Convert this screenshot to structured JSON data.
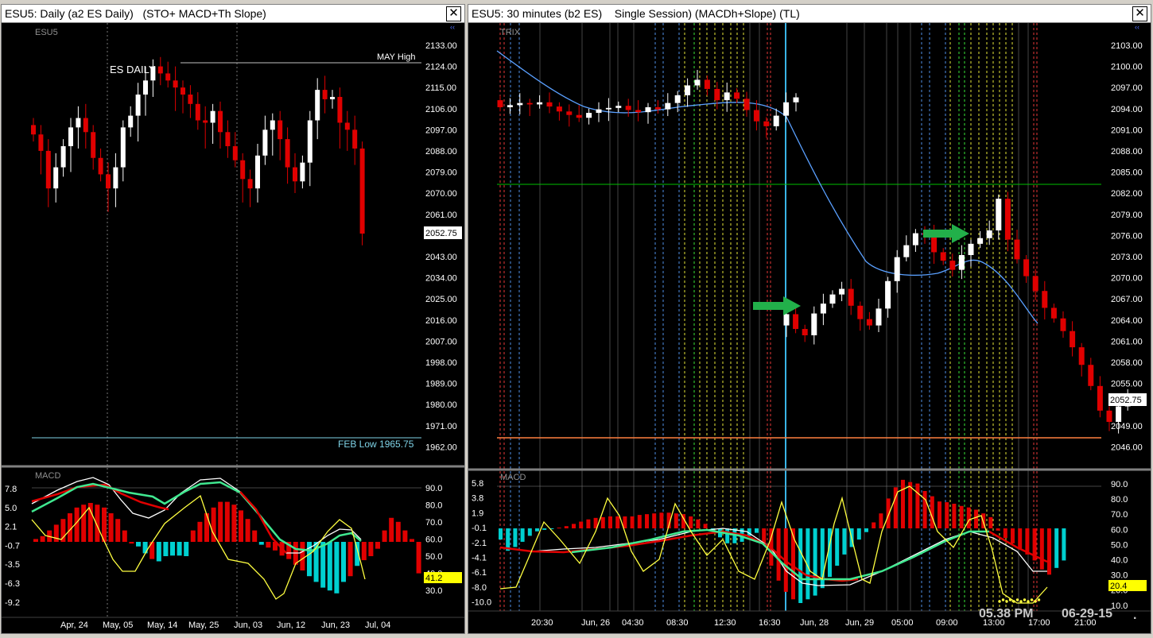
{
  "left_window": {
    "title": "ESU5: Daily (a2 ES Daily)   (STO+ MACD+Th Slope)",
    "symbol_label": "ESU5",
    "chart_title": "ES DAILY",
    "may_high_label": "MAY  High",
    "feb_low_label": "FEB Low 1965.75",
    "last_price": "2052.75",
    "price_ticks": [
      "2133.00",
      "2124.00",
      "2115.00",
      "2106.00",
      "2097.00",
      "2088.00",
      "2079.00",
      "2070.00",
      "2061.00",
      "2052.75",
      "2043.00",
      "2034.00",
      "2025.00",
      "2016.00",
      "2007.00",
      "1998.00",
      "1989.00",
      "1980.00",
      "1971.00",
      "1962.00"
    ],
    "macd_label": "MACD",
    "macd_left_ticks": [
      "7.8",
      "5.0",
      "2.1",
      "-0.7",
      "-3.5",
      "-6.3",
      "-9.2"
    ],
    "macd_right_ticks": [
      "90.0",
      "80.0",
      "70.0",
      "60.0",
      "50.0",
      "40.0",
      "30.0"
    ],
    "macd_value": "41.2",
    "date_ticks": [
      "Apr, 24",
      "May, 05",
      "May, 14",
      "May, 25",
      "Jun, 03",
      "Jun, 12",
      "Jun, 23",
      "Jul, 04"
    ]
  },
  "right_window": {
    "title": "ESU5: 30 minutes (b2 ES)    Single Session) (MACDh+Slope) (TL)",
    "indicator_label": "TRIX",
    "last_price": "2052.75",
    "price_ticks": [
      "2103.00",
      "2100.00",
      "2097.00",
      "2094.00",
      "2091.00",
      "2088.00",
      "2085.00",
      "2082.00",
      "2079.00",
      "2076.00",
      "2073.00",
      "2070.00",
      "2067.00",
      "2064.00",
      "2061.00",
      "2058.00",
      "2055.00",
      "2052.75",
      "2049.00",
      "2046.00"
    ],
    "macd_label": "MACD",
    "macd_left_ticks": [
      "5.8",
      "3.8",
      "1.9",
      "-0.1",
      "-2.1",
      "-4.1",
      "-6.1",
      "-8.0",
      "-10.0"
    ],
    "macd_right_ticks": [
      "90.0",
      "80.0",
      "70.0",
      "60.0",
      "50.0",
      "40.0",
      "30.0",
      "20.0",
      "10.0"
    ],
    "macd_value": "20.4",
    "time_ticks": [
      "20:30",
      "Jun, 26",
      "04:30",
      "08:30",
      "12:30",
      "16:30",
      "Jun, 28",
      "Jun, 29",
      "05:00",
      "09:00",
      "13:00",
      "17:00",
      "21:00"
    ],
    "timestamp_time": "05.38 PM",
    "timestamp_date": "06-29-15",
    "trailing_dot": "."
  },
  "chart_data": [
    {
      "type": "candlestick",
      "title": "ES DAILY",
      "ylim": [
        1962,
        2133
      ],
      "close_values": [
        2095,
        2088,
        2072,
        2081,
        2090,
        2098,
        2102,
        2096,
        2085,
        2078,
        2072,
        2081,
        2098,
        2103,
        2112,
        2118,
        2124,
        2121,
        2118,
        2115,
        2112,
        2108,
        2101,
        2100,
        2105,
        2096,
        2090,
        2084,
        2076,
        2072,
        2086,
        2097,
        2101,
        2093,
        2081,
        2075,
        2083,
        2101,
        2114,
        2110,
        2111,
        2100,
        2097,
        2089,
        2052.75
      ],
      "annotations": [
        {
          "label": "MAY  High",
          "value": 2124
        },
        {
          "label": "FEB Low 1965.75",
          "value": 1965.75
        }
      ],
      "grid": false
    },
    {
      "type": "candlestick",
      "title": "ESU5 30 minutes",
      "ylim": [
        2046,
        2103
      ],
      "close_values": [
        2094.2,
        2094.5,
        2094.8,
        2094.6,
        2094.9,
        2094.3,
        2093.6,
        2093.1,
        2092.7,
        2093.4,
        2093.9,
        2094.1,
        2094.4,
        2093.8,
        2093.5,
        2094.2,
        2093.9,
        2094.8,
        2095.9,
        2097.3,
        2098.1,
        2096.8,
        2095.2,
        2096.3,
        2095.4,
        2093.8,
        2092.2,
        2091.5,
        2093.0,
        2094.9,
        2095.6,
        2064.8,
        2062.7,
        2061.8,
        2064.9,
        2066.3,
        2067.6,
        2068.4,
        2066.0,
        2064.1,
        2063.2,
        2065.6,
        2069.5,
        2072.9,
        2074.6,
        2076.3,
        2076.1,
        2073.6,
        2072.4,
        2071.1,
        2073.2,
        2074.8,
        2075.6,
        2076.7,
        2081.2,
        2075.4,
        2072.6,
        2070.2,
        2068.1,
        2065.7,
        2064.2,
        2062.4,
        2060.1,
        2057.6,
        2054.6,
        2051.1,
        2049.5,
        2051.7,
        2052.75
      ],
      "annotations": [
        {
          "value": 2083.3,
          "color": "#00c000"
        },
        {
          "value": 2047.2,
          "color": "#ff8040"
        }
      ],
      "grid": false
    }
  ],
  "colors": {
    "up_candle": "#ffffff",
    "down_candle": "#e00000",
    "trix_line": "#5aa0ff",
    "macd_hist_up": "#e00000",
    "macd_hist_down": "#00d0d0",
    "slope_line": "#ffff40",
    "signal_line": "#40e890"
  }
}
